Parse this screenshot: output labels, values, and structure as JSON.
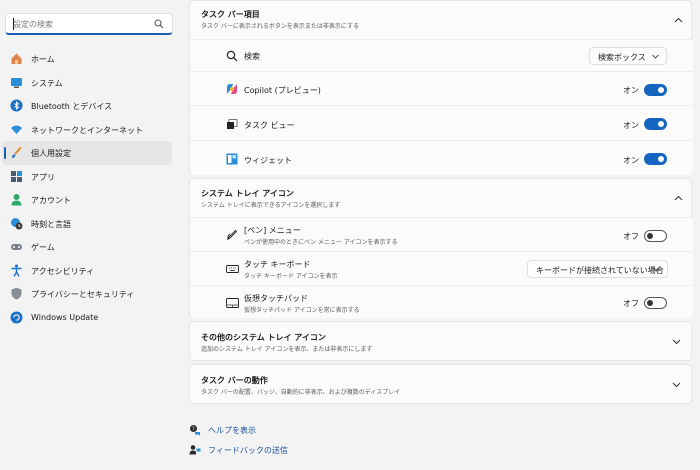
{
  "sidebar": {
    "search_placeholder": "設定の検索",
    "items": [
      {
        "label": "ホーム",
        "icon": "home-icon"
      },
      {
        "label": "システム",
        "icon": "system-icon"
      },
      {
        "label": "Bluetooth とデバイス",
        "icon": "bluetooth-icon"
      },
      {
        "label": "ネットワークとインターネット",
        "icon": "wifi-icon"
      },
      {
        "label": "個人用設定",
        "icon": "brush-icon",
        "active": true
      },
      {
        "label": "アプリ",
        "icon": "apps-icon"
      },
      {
        "label": "アカウント",
        "icon": "account-icon"
      },
      {
        "label": "時刻と言語",
        "icon": "clock-globe-icon"
      },
      {
        "label": "ゲーム",
        "icon": "gamepad-icon"
      },
      {
        "label": "アクセシビリティ",
        "icon": "accessibility-icon"
      },
      {
        "label": "プライバシーとセキュリティ",
        "icon": "shield-icon"
      },
      {
        "label": "Windows Update",
        "icon": "update-icon"
      }
    ]
  },
  "taskbar_items": {
    "title": "タスク バー項目",
    "description": "タスク バーに表示されるボタンを表示または非表示にする",
    "rows": [
      {
        "label": "検索",
        "icon": "search-icon",
        "dropdown": "検索ボックス"
      },
      {
        "label": "Copilot (プレビュー)",
        "icon": "copilot-icon",
        "state": "オン",
        "toggle": "on"
      },
      {
        "label": "タスク ビュー",
        "icon": "task-view-icon",
        "state": "オン",
        "toggle": "on"
      },
      {
        "label": "ウィジェット",
        "icon": "widgets-icon",
        "state": "オン",
        "toggle": "on"
      }
    ]
  },
  "tray_icons": {
    "title": "システム トレイ アイコン",
    "description": "システム トレイに表示できるアイコンを選択します",
    "rows": [
      {
        "label": "[ペン] メニュー",
        "sub": "ペンが使用中のときにペン メニュー アイコンを表示する",
        "icon": "pen-icon",
        "state": "オフ",
        "toggle": "off"
      },
      {
        "label": "タッチ キーボード",
        "sub": "タッチ キーボード アイコンを表示",
        "icon": "keyboard-icon",
        "dropdown": "キーボードが接続されていない場合"
      },
      {
        "label": "仮想タッチパッド",
        "sub": "仮想タッチパッド アイコンを常に表示する",
        "icon": "touchpad-icon",
        "state": "オフ",
        "toggle": "off"
      }
    ]
  },
  "other_tray": {
    "title": "その他のシステム トレイ アイコン",
    "description": "追加のシステム トレイ アイコンを表示、または非表示にします"
  },
  "behaviors": {
    "title": "タスク バーの動作",
    "description": "タスク バーの配置、バッジ、自動的に非表示、および複数のディスプレイ"
  },
  "links": {
    "help": "ヘルプを表示",
    "feedback": "フィードバックの送信"
  },
  "colors": {
    "accent": "#1565c0",
    "link": "#1a4f9c"
  }
}
